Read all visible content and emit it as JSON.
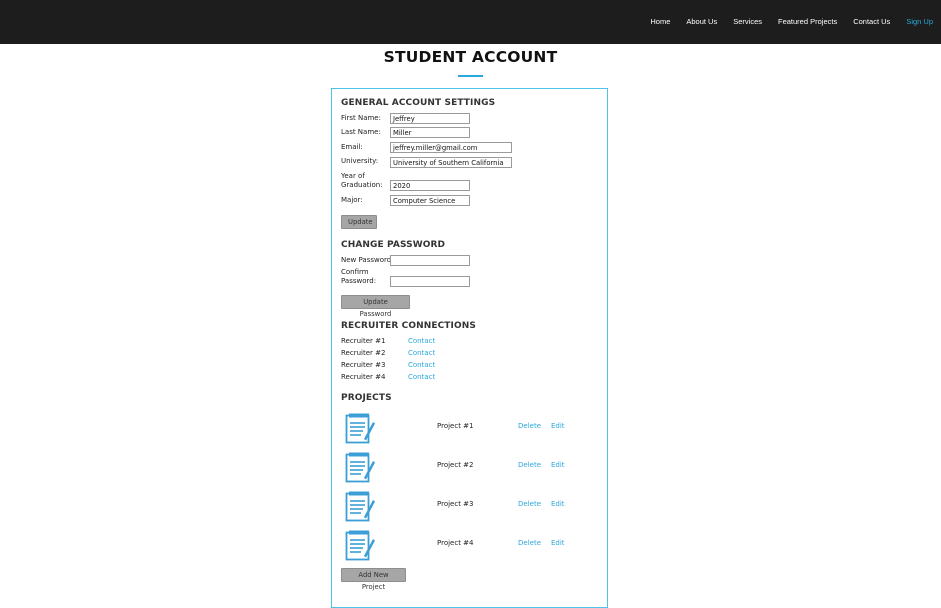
{
  "nav": {
    "items": [
      "Home",
      "About Us",
      "Services",
      "Featured Projects",
      "Contact Us"
    ],
    "signup": "Sign Up"
  },
  "page_title": "STUDENT ACCOUNT",
  "general": {
    "heading": "GENERAL ACCOUNT SETTINGS",
    "first_name_label": "First Name:",
    "first_name": "Jeffrey",
    "last_name_label": "Last Name:",
    "last_name": "Miller",
    "email_label": "Email:",
    "email": "jeffrey.miller@gmail.com",
    "university_label": "University:",
    "university": "University of Southern California",
    "year_label_1": "Year of",
    "year_label_2": "Graduation:",
    "year": "2020",
    "major_label": "Major:",
    "major": "Computer Science",
    "update_button": "Update"
  },
  "password": {
    "heading": "CHANGE PASSWORD",
    "new_label": "New Password:",
    "confirm_label_1": "Confirm",
    "confirm_label_2": "Password:",
    "update_button": "Update Password"
  },
  "recruiters": {
    "heading": "RECRUITER CONNECTIONS",
    "items": [
      {
        "name": "Recruiter #1",
        "action": "Contact"
      },
      {
        "name": "Recruiter #2",
        "action": "Contact"
      },
      {
        "name": "Recruiter #3",
        "action": "Contact"
      },
      {
        "name": "Recruiter #4",
        "action": "Contact"
      }
    ]
  },
  "projects": {
    "heading": "PROJECTS",
    "items": [
      {
        "name": "Project #1",
        "delete": "Delete",
        "edit": "Edit",
        "icon": "document-icon"
      },
      {
        "name": "Project #2",
        "delete": "Delete",
        "edit": "Edit",
        "icon": "document-icon"
      },
      {
        "name": "Project #3",
        "delete": "Delete",
        "edit": "Edit",
        "icon": "document-icon"
      },
      {
        "name": "Project #4",
        "delete": "Delete",
        "edit": "Edit",
        "icon": "document-icon"
      }
    ],
    "add_button": "Add New Project"
  },
  "colors": {
    "topbar": "#1d1d1d",
    "accent": "#2aa8dd",
    "card_border": "#4cc3e8",
    "button": "#a6a6a6"
  }
}
